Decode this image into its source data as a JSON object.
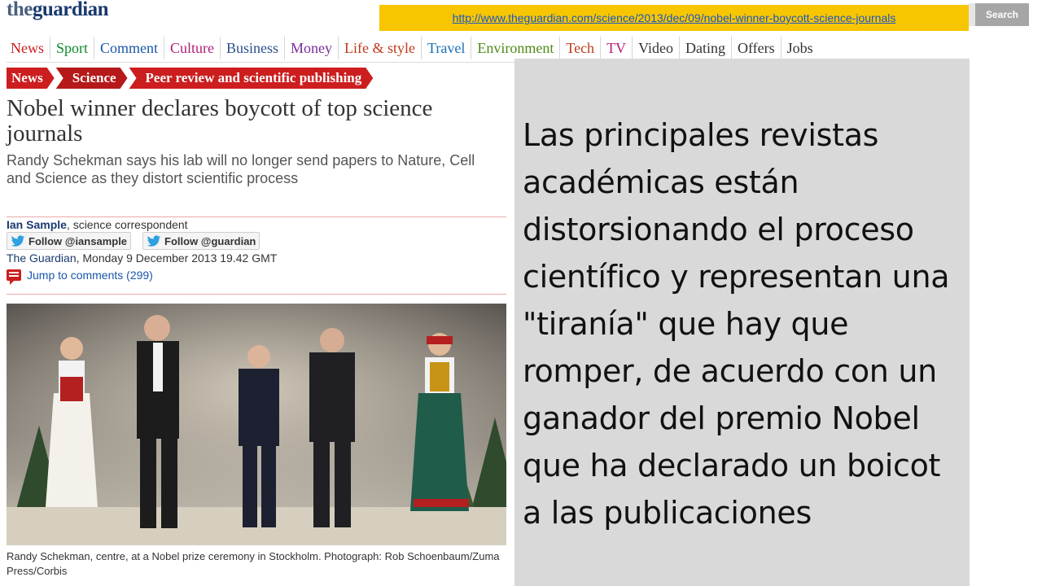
{
  "brand": {
    "the": "the",
    "name": "guardian"
  },
  "url": "http://www.theguardian.com/science/2013/dec/09/nobel-winner-boycott-science-journals",
  "search": {
    "button_label": "Search"
  },
  "nav": [
    {
      "label": "News",
      "color": "#cc1e1e"
    },
    {
      "label": "Sport",
      "color": "#0f8a2d"
    },
    {
      "label": "Comment",
      "color": "#1a56a6"
    },
    {
      "label": "Culture",
      "color": "#b51c7a"
    },
    {
      "label": "Business",
      "color": "#2a4d8e"
    },
    {
      "label": "Money",
      "color": "#7a2d9c"
    },
    {
      "label": "Life & style",
      "color": "#c0391b"
    },
    {
      "label": "Travel",
      "color": "#1a6fb5"
    },
    {
      "label": "Environment",
      "color": "#4e8a16"
    },
    {
      "label": "Tech",
      "color": "#c0391b"
    },
    {
      "label": "TV",
      "color": "#b51c7a"
    },
    {
      "label": "Video",
      "color": "#333333"
    },
    {
      "label": "Dating",
      "color": "#333333"
    },
    {
      "label": "Offers",
      "color": "#333333"
    },
    {
      "label": "Jobs",
      "color": "#333333"
    }
  ],
  "breadcrumbs": [
    "News",
    "Science",
    "Peer review and scientific publishing"
  ],
  "article": {
    "headline": "Nobel winner declares boycott of top science journals",
    "standfirst": "Randy Schekman says his lab will no longer send papers to Nature, Cell and Science as they distort scientific process",
    "author": "Ian Sample",
    "author_role": ", science correspondent",
    "follow_buttons": [
      "Follow @iansample",
      "Follow @guardian"
    ],
    "publication": "The Guardian",
    "date": ", Monday 9 December 2013 19.42 GMT",
    "comments_link": "Jump to comments (299)",
    "caption": "Randy Schekman, centre, at a Nobel prize ceremony in Stockholm. Photograph: Rob Schoenbaum/Zuma Press/Corbis"
  },
  "overlay": {
    "text": "Las principales revistas académicas están distorsionando el proceso científico y representan una \"tiranía\" que hay que romper, de acuerdo con un ganador del premio Nobel que ha declarado un boicot a las publicaciones"
  }
}
